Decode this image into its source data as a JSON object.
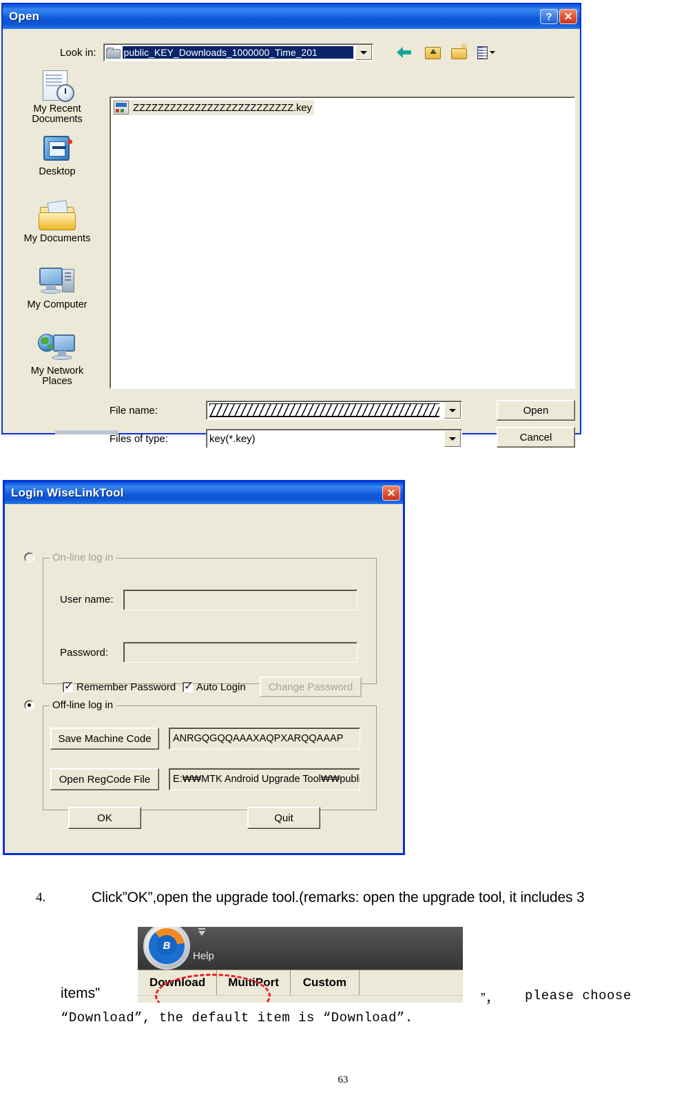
{
  "open_dialog": {
    "title": "Open",
    "help_button": "?",
    "close_button": "✕",
    "lookin_label": "Look in:",
    "lookin_value": "public_KEY_Downloads_1000000_Time_201",
    "toolbar_icons": [
      "back-icon",
      "up-one-level-icon",
      "new-folder-icon",
      "views-icon"
    ],
    "places": [
      {
        "label_line1": "My Recent",
        "label_line2": "Documents",
        "icon": "recent-documents-icon"
      },
      {
        "label_line1": "Desktop",
        "label_line2": "",
        "icon": "desktop-icon"
      },
      {
        "label_line1": "My Documents",
        "label_line2": "",
        "icon": "my-documents-icon"
      },
      {
        "label_line1": "My Computer",
        "label_line2": "",
        "icon": "my-computer-icon"
      },
      {
        "label_line1": "My Network",
        "label_line2": "Places",
        "icon": "my-network-places-icon"
      }
    ],
    "files": [
      {
        "name": "ZZZZZZZZZZZZZZZZZZZZZZZZZZ.key",
        "icon": "key-file-icon"
      }
    ],
    "file_name_label": "File name:",
    "file_name_value": "",
    "files_of_type_label": "Files of type:",
    "files_of_type_value": "key(*.key)",
    "open_button": "Open",
    "cancel_button": "Cancel"
  },
  "login_dialog": {
    "title": "Login WiseLinkTool",
    "close_button": "✕",
    "online_group": {
      "legend": "On-line log in",
      "username_label": "User name:",
      "username_value": "",
      "password_label": "Password:",
      "password_value": "",
      "remember_password_label": "Remember Password",
      "auto_login_label": "Auto Login",
      "change_password_button": "Change Password"
    },
    "offline_group": {
      "legend": "Off-line log in",
      "save_machine_code_button": "Save Machine Code",
      "machine_code_value": "ANRGQGQQAAAXAQPXARQQAAAP",
      "open_regcode_button": "Open RegCode File",
      "regcode_path_value": "E:₩₩MTK Android Upgrade Tool₩₩public_"
    },
    "ok_button": "OK",
    "quit_button": "Quit"
  },
  "document": {
    "step_number": "4.",
    "step_text": "Click”OK”,open the upgrade tool.(remarks: open the upgrade tool, it includes 3",
    "items_word": "items”",
    "tail_quote": "”，",
    "please_choose": "please    choose",
    "last_line": "“Download”, the default item is “Download”.",
    "page_number": "63"
  },
  "tool_screenshot": {
    "logo_letter": "B",
    "help_menu": "Help",
    "tabs": [
      "Download",
      "MultiPort",
      "Custom"
    ],
    "highlight": {
      "target": "Download",
      "color": "#f21a1a",
      "shape": "ellipse"
    }
  }
}
